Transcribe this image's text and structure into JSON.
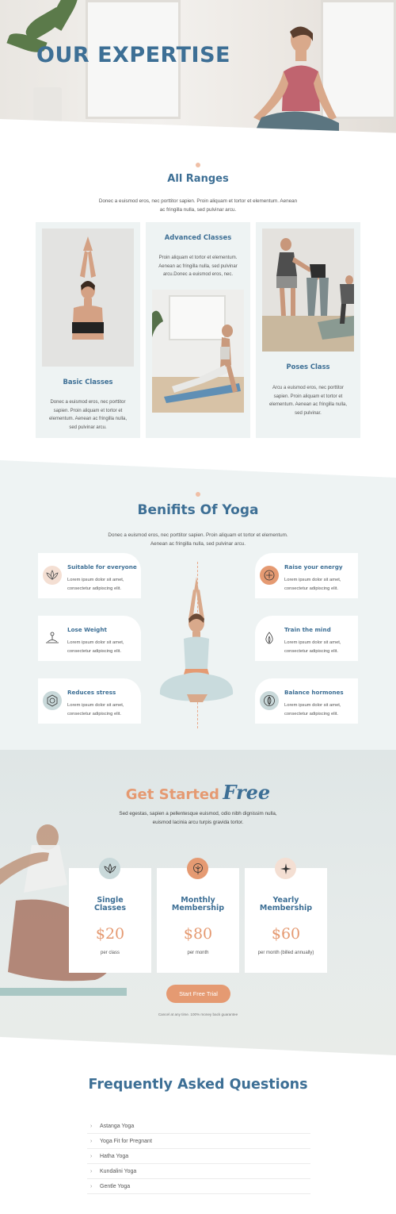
{
  "hero": {
    "title": "OUR EXPERTISE"
  },
  "ranges": {
    "title": "All Ranges",
    "subtitle_line1": "Donec a euismod eros, nec porttitor sapien. Proin aliquam et tortor et elementum. Aenean",
    "subtitle_line2": "ac fringilla nulla, sed pulvinar arcu.",
    "cards": [
      {
        "title": "Basic Classes",
        "lines": [
          "Donec a euismod eros, nec porttitor",
          "sapien. Proin aliquam et tortor et",
          "elementum. Aenean ac fringilla nulla,",
          "sed pulvinar arcu."
        ]
      },
      {
        "title": "Advanced Classes",
        "lines": [
          "Proin aliquam et tortor et elementum.",
          "Aenean ac fringilla nulla, sed pulvinar",
          "arcu.Donec a euismod eros, nec."
        ]
      },
      {
        "title": "Poses Class",
        "lines": [
          "Arcu a euismod eros, nec porttitor",
          "sapien. Proin aliquam et tortor et",
          "elementum. Aenean ac fringilla nulla,",
          "sed pulvinar."
        ]
      }
    ]
  },
  "benefits": {
    "title": "Benifits Of Yoga",
    "subtitle_line1": "Donec a euismod eros, nec porttitor sapien. Proin aliquam et tortor et elementum.",
    "subtitle_line2": "Aenean ac fringilla nulla, sed pulvinar arcu.",
    "items": [
      {
        "title": "Suitable for everyone",
        "line1": "Lorem ipsum dolor sit amet,",
        "line2": "consectetur adipiscing elit.",
        "icon": "lotus-icon"
      },
      {
        "title": "Raise your energy",
        "line1": "Lorem ipsum dolor sit amet,",
        "line2": "consectetur adipiscing elit.",
        "icon": "energy-icon"
      },
      {
        "title": "Lose Weight",
        "line1": "Lorem ipsum dolor sit amet,",
        "line2": "consectetur adipiscing elit.",
        "icon": "meditation-icon"
      },
      {
        "title": "Train the mind",
        "line1": "Lorem ipsum dolor sit amet,",
        "line2": "consectetur adipiscing elit.",
        "icon": "flame-icon"
      },
      {
        "title": "Reduces stress",
        "line1": "Lorem ipsum dolor sit amet,",
        "line2": "consectetur adipiscing elit.",
        "icon": "hexagon-icon"
      },
      {
        "title": "Balance hormones",
        "line1": "Lorem ipsum dolor sit amet,",
        "line2": "consectetur adipiscing elit.",
        "icon": "leaf-icon"
      }
    ]
  },
  "get_started": {
    "title": "Get Started",
    "title_script": "Free",
    "subtitle_line1": "Sed egestas, sapien a pellentesque euismod, odio nibh dignissim nulla,",
    "subtitle_line2": "euismod lacinia arcu turpis gravida tortor.",
    "plans": [
      {
        "title_line1": "Single",
        "title_line2": "Classes",
        "price": "$20",
        "unit": "per class",
        "icon": "lotus-icon"
      },
      {
        "title_line1": "Monthly",
        "title_line2": "Membership",
        "price": "$80",
        "unit": "per month",
        "icon": "tree-icon"
      },
      {
        "title_line1": "Yearly",
        "title_line2": "Membership",
        "price": "$60",
        "unit": "per month (billed annually)",
        "icon": "flower-icon"
      }
    ],
    "button": "Start Free Trial",
    "guarantee": "Cancel at any time. 100% money back guarantee"
  },
  "faq": {
    "title": "Frequently Asked Questions",
    "items": [
      "Astanga Yoga",
      "Yoga Fit for Pregnant",
      "Hatha Yoga",
      "Kundalini Yoga",
      "Gentle Yoga"
    ]
  },
  "colors": {
    "primary": "#3d6f95",
    "accent": "#e59a72",
    "section_bg": "#eef3f3"
  }
}
